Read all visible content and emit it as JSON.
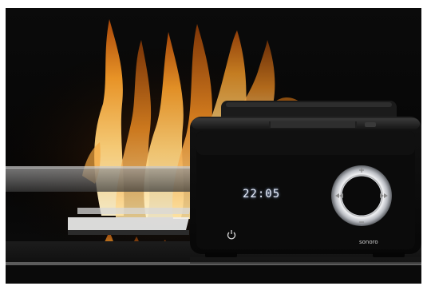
{
  "photo": {
    "clock_display": "22:05",
    "brand_logo": "sonoro",
    "icons": [
      "power-icon",
      "skip-back-icon",
      "skip-forward-icon",
      "volume-up-icon",
      "volume-down-icon"
    ],
    "colors": {
      "background": "#060606",
      "flame_core": "#ffe7a6",
      "flame_outer": "#d96a10",
      "radio_body": "#0e0e0e",
      "dial_ring": "#d8dbe0",
      "display": "#e8eefc"
    }
  }
}
